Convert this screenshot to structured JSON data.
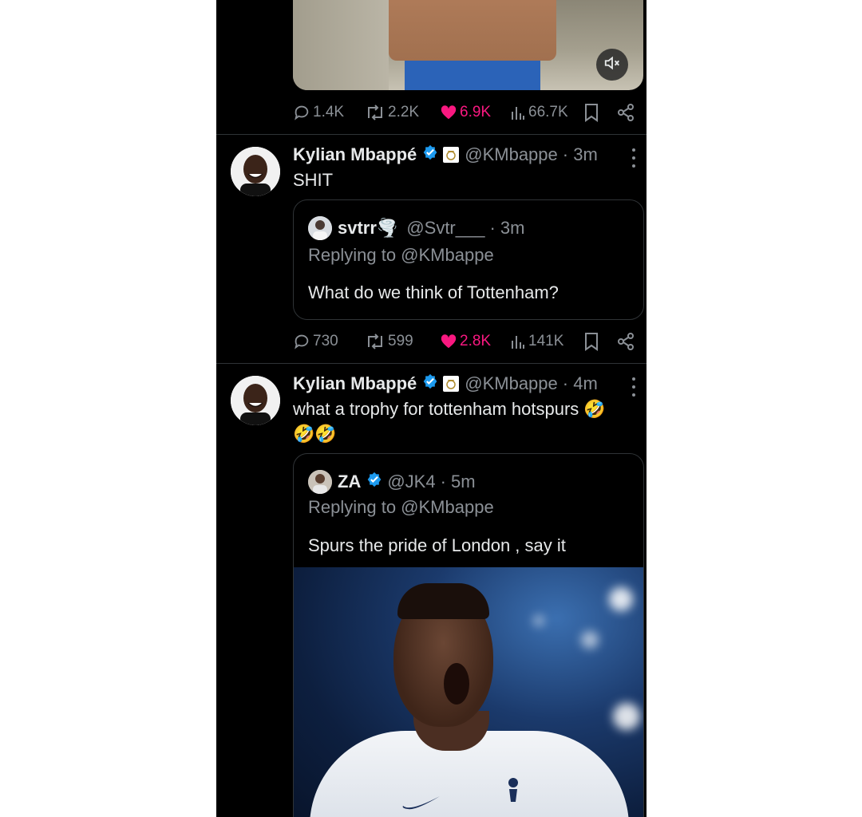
{
  "top_tweet": {
    "actions": {
      "replies": "1.4K",
      "retweets": "2.2K",
      "likes": "6.9K",
      "views": "66.7K"
    },
    "media": {
      "mute_icon": "speaker-muted-icon"
    }
  },
  "tweet1": {
    "name": "Kylian Mbappé",
    "handle": "@KMbappe",
    "time": "· 3m",
    "text": "SHIT",
    "quote": {
      "name": "svtrr🌪️",
      "handle": "@Svtr___",
      "time": "· 3m",
      "replying": "Replying to @KMbappe",
      "text": "What do we think of Tottenham?"
    },
    "actions": {
      "replies": "730",
      "retweets": "599",
      "likes": "2.8K",
      "views": "141K"
    }
  },
  "tweet2": {
    "name": "Kylian Mbappé",
    "handle": "@KMbappe",
    "time": "· 4m",
    "text_line1": "what a trophy for tottenham hotspurs 🤣",
    "text_line2": "🤣🤣",
    "quote": {
      "name": "ZA",
      "handle": "@JK4",
      "time": "· 5m",
      "replying": "Replying to @KMbappe",
      "text": "Spurs the pride of London , say it"
    }
  },
  "colors": {
    "background": "#000000",
    "like": "#f91880",
    "verified": "#1d9bf0",
    "muted_text": "#8b9096"
  }
}
